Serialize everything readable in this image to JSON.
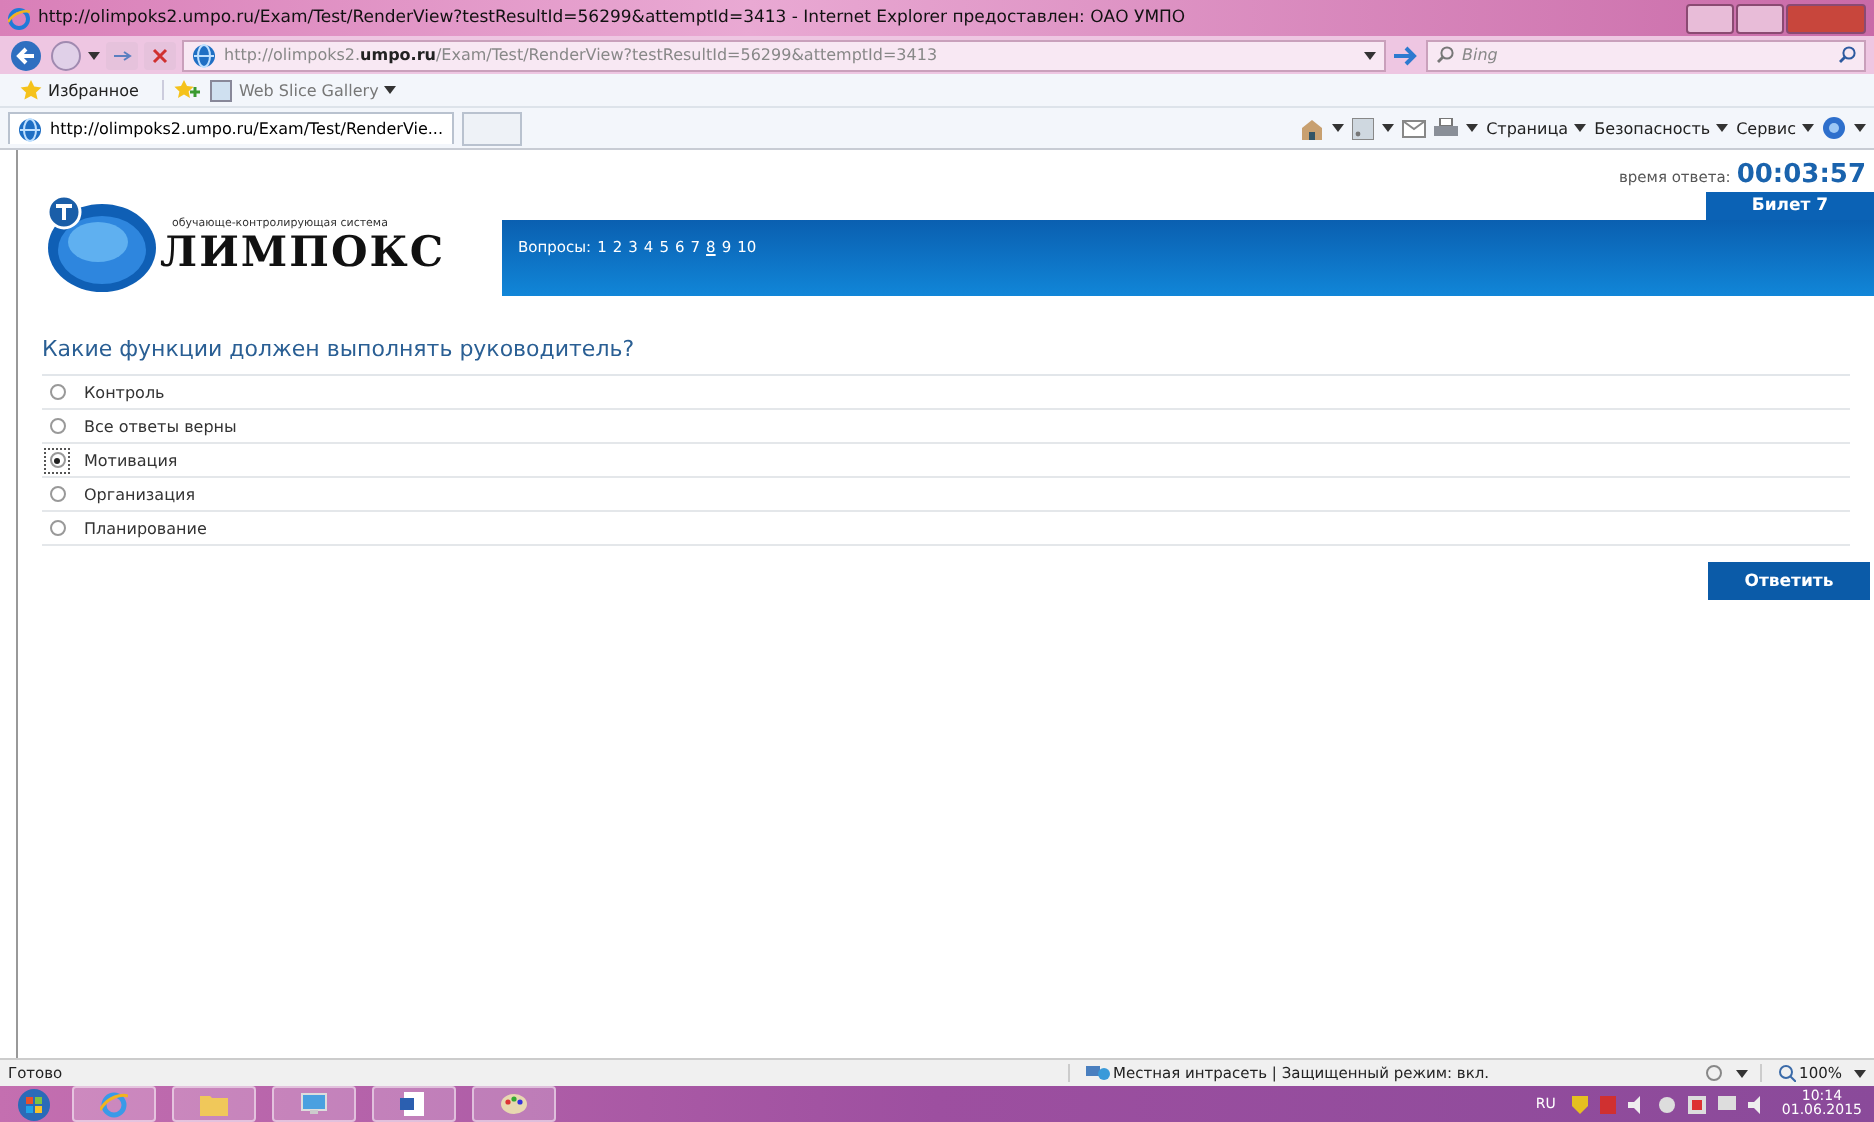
{
  "window": {
    "title": "http://olimpoks2.umpo.ru/Exam/Test/RenderView?testResultId=56299&attemptId=3413 - Internet Explorer предоставлен: ОАО УМПО"
  },
  "address_bar": {
    "url": "http://olimpoks2.**umpo.ru**/Exam/Test/RenderView?testResultId=56299&attemptId=3413"
  },
  "search": {
    "placeholder": "Bing"
  },
  "favorites_bar": {
    "favorites": "Избранное",
    "items": [
      "Web Slice Gallery"
    ]
  },
  "tabs": [
    {
      "label": "http://olimpoks2.umpo.ru/Exam/Test/RenderVie...",
      "selected": true
    }
  ],
  "command_bar": [
    "Страница",
    "Безопасность",
    "Сервис"
  ],
  "page": {
    "logo": {
      "tagline": "обучающе-контролирующая система",
      "name": "ЛИМПОКС"
    },
    "questions_label": "Вопросы:",
    "questions": [
      {
        "label": "1",
        "selected": false
      },
      {
        "label": "2",
        "selected": false
      },
      {
        "label": "3",
        "selected": false
      },
      {
        "label": "4",
        "selected": false
      },
      {
        "label": "5",
        "selected": false
      },
      {
        "label": "6",
        "selected": false
      },
      {
        "label": "7",
        "selected": false
      },
      {
        "label": "8",
        "selected": true
      },
      {
        "label": "9",
        "selected": false
      },
      {
        "label": "10",
        "selected": false
      }
    ],
    "timer_label": "время ответа:",
    "timer": "00:03:57",
    "ticket": "Билет 7",
    "question": "Какие функции должен выполнять руководитель?",
    "options": [
      {
        "label": "Контроль",
        "selected": false
      },
      {
        "label": "Все ответы верны",
        "selected": false
      },
      {
        "label": "Мотивация",
        "selected": true
      },
      {
        "label": "Организация",
        "selected": false
      },
      {
        "label": "Планирование",
        "selected": false
      }
    ],
    "submit": "Ответить"
  },
  "status_bar": {
    "text": "Готово",
    "zone": "Местная интрасеть | Защищенный режим: вкл.",
    "zoom": "100%"
  },
  "taskbar": {
    "language": "RU",
    "time": "10:14",
    "date": "01.06.2015"
  }
}
